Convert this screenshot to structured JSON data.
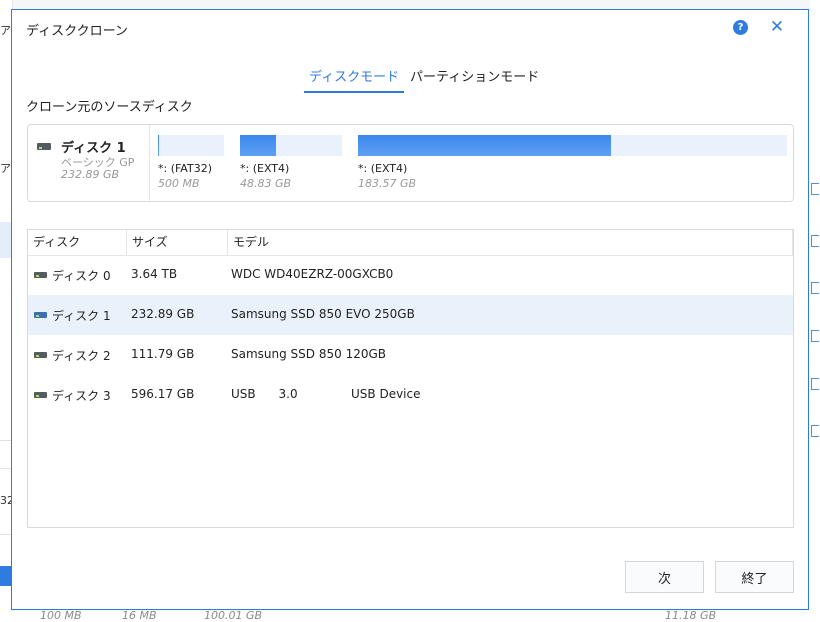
{
  "dialog": {
    "title": "ディスククローン",
    "help_glyph": "?",
    "close_glyph": "✕"
  },
  "tabs": [
    {
      "label": "ディスクモード",
      "active": true
    },
    {
      "label": "パーティションモード",
      "active": false
    }
  ],
  "source": {
    "section_label": "クローン元のソースディスク",
    "disk_name": "ディスク 1",
    "disk_type": "ベーシック GP",
    "disk_size": "232.89 GB",
    "partitions": [
      {
        "label": "*: (FAT32)",
        "size": "500 MB",
        "fill": 0.02
      },
      {
        "label": "*: (EXT4)",
        "size": "48.83 GB",
        "fill": 0.35
      },
      {
        "label": "*: (EXT4)",
        "size": "183.57 GB",
        "fill": 0.59
      }
    ]
  },
  "table": {
    "headers": {
      "disk": "ディスク",
      "size": "サイズ",
      "model": "モデル"
    },
    "rows": [
      {
        "name": "ディスク 0",
        "size": "3.64 TB",
        "model": "WDC WD40EZRZ-00GXCB0",
        "selected": false
      },
      {
        "name": "ディスク 1",
        "size": "232.89 GB",
        "model": "Samsung SSD 850 EVO 250GB",
        "selected": true
      },
      {
        "name": "ディスク 2",
        "size": "111.79 GB",
        "model": "Samsung SSD 850 120GB",
        "selected": false
      },
      {
        "name": "ディスク 3",
        "size": "596.17 GB",
        "model": "USB      3.0              USB Device",
        "selected": false
      }
    ]
  },
  "buttons": {
    "next": "次",
    "finish": "終了"
  },
  "background": {
    "bottom_values": [
      "100 MB",
      "16 MB",
      "100.01 GB",
      "11.18 GB"
    ],
    "left_fragments": [
      "ア",
      "ア",
      "32"
    ]
  },
  "colors": {
    "accent": "#2f7be0",
    "selected_row": "#e9f1fa",
    "partition_fill": "#3a88ec",
    "partition_empty": "#e8f1fc"
  }
}
